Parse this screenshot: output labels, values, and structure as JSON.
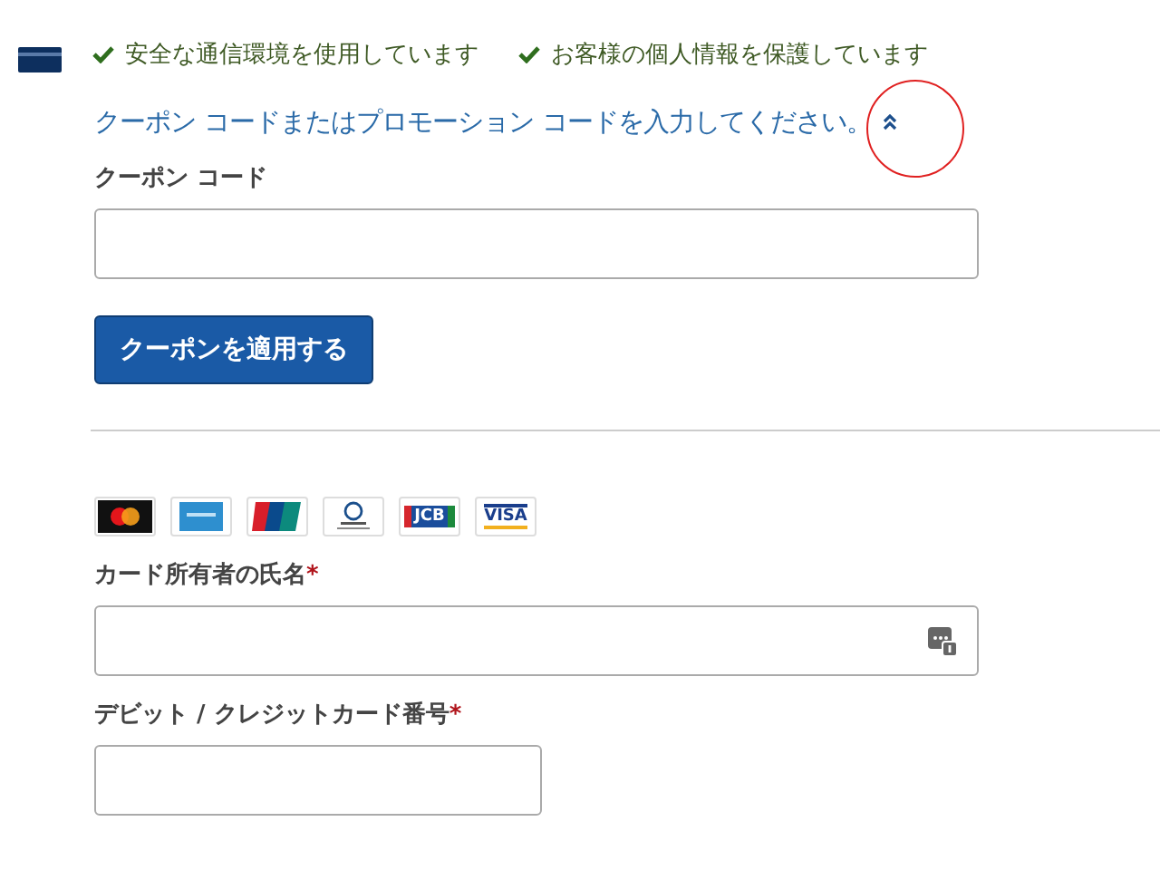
{
  "assurances": [
    "安全な通信環境を使用しています",
    "お客様の個人情報を保護しています"
  ],
  "coupon": {
    "toggle_text": "クーポン コードまたはプロモーション コードを入力してください。",
    "expanded": true,
    "label": "クーポン コード",
    "apply_button": "クーポンを適用する"
  },
  "card_logos": [
    {
      "kind": "mastercard"
    },
    {
      "kind": "amex"
    },
    {
      "kind": "unionpay"
    },
    {
      "kind": "diners"
    },
    {
      "kind": "jcb",
      "text": "JCB"
    },
    {
      "kind": "visa",
      "text": "VISA"
    }
  ],
  "fields": [
    {
      "label": "カード所有者の氏名",
      "required": true,
      "wide": true,
      "autofill_icon": true
    },
    {
      "label": "デビット / クレジットカード番号",
      "required": true,
      "wide": false,
      "autofill_icon": false
    }
  ],
  "required_mark": "*"
}
